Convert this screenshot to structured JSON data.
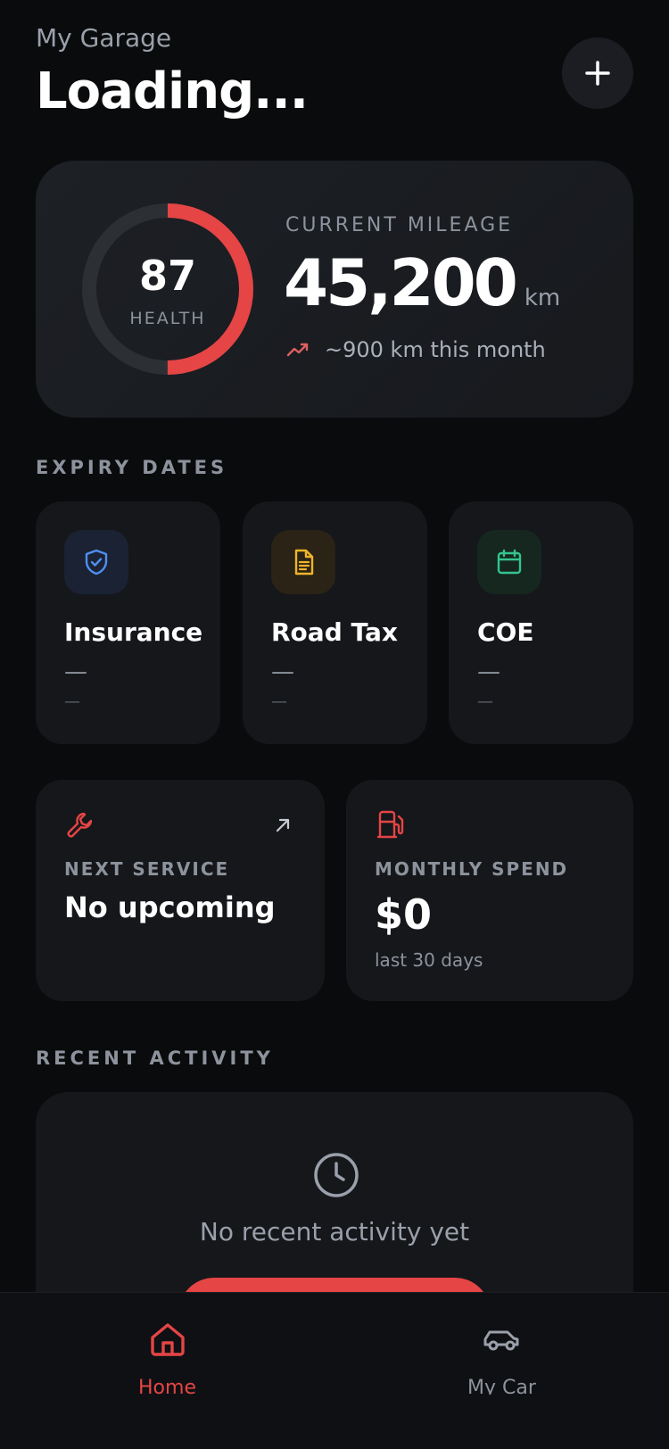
{
  "header": {
    "subtitle": "My Garage",
    "title": "Loading..."
  },
  "health": {
    "value": "87",
    "label": "HEALTH",
    "fraction": 0.5
  },
  "mileage": {
    "label": "CURRENT MILEAGE",
    "value": "45,200",
    "unit": "km",
    "trend": "~900 km this month"
  },
  "sections": {
    "expiry": "EXPIRY DATES",
    "recent": "RECENT ACTIVITY"
  },
  "expiry": [
    {
      "title": "Insurance",
      "date": "—",
      "days": "—",
      "icon": "shield-check-icon",
      "color": "#4f8ff0",
      "bg": "#1a2233"
    },
    {
      "title": "Road Tax",
      "date": "—",
      "days": "—",
      "icon": "document-icon",
      "color": "#f0b429",
      "bg": "#2a2316"
    },
    {
      "title": "COE",
      "date": "—",
      "days": "—",
      "icon": "calendar-icon",
      "color": "#34c38f",
      "bg": "#15271f"
    }
  ],
  "service": {
    "label": "NEXT SERVICE",
    "value": "No upcoming",
    "icon": "wrench-icon"
  },
  "spend": {
    "label": "MONTHLY SPEND",
    "value": "$0",
    "sub": "last 30 days",
    "icon": "fuel-pump-icon"
  },
  "activity": {
    "empty_text": "No recent activity yet"
  },
  "nav": {
    "home": "Home",
    "car": "My Car"
  },
  "colors": {
    "accent": "#e54545",
    "muted": "#8d939d"
  }
}
